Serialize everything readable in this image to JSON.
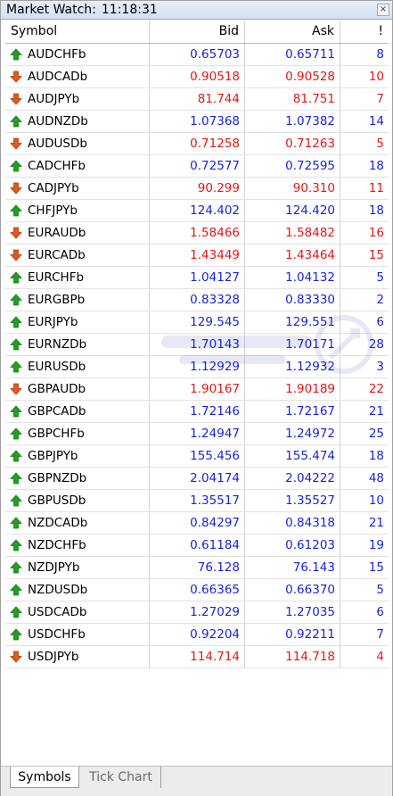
{
  "window": {
    "title": "Market Watch:",
    "time": "11:18:31",
    "close_glyph": "×"
  },
  "columns": {
    "symbol": "Symbol",
    "bid": "Bid",
    "ask": "Ask",
    "spread": "!"
  },
  "colors": {
    "up": "#1a24d6",
    "down": "#e01818",
    "arrow_up": "#1fa01f",
    "arrow_down": "#e05a1c"
  },
  "rows": [
    {
      "symbol": "AUDCHFb",
      "bid": "0.65703",
      "ask": "0.65711",
      "spread": "8",
      "dir": "up"
    },
    {
      "symbol": "AUDCADb",
      "bid": "0.90518",
      "ask": "0.90528",
      "spread": "10",
      "dir": "down"
    },
    {
      "symbol": "AUDJPYb",
      "bid": "81.744",
      "ask": "81.751",
      "spread": "7",
      "dir": "down"
    },
    {
      "symbol": "AUDNZDb",
      "bid": "1.07368",
      "ask": "1.07382",
      "spread": "14",
      "dir": "up"
    },
    {
      "symbol": "AUDUSDb",
      "bid": "0.71258",
      "ask": "0.71263",
      "spread": "5",
      "dir": "down"
    },
    {
      "symbol": "CADCHFb",
      "bid": "0.72577",
      "ask": "0.72595",
      "spread": "18",
      "dir": "up"
    },
    {
      "symbol": "CADJPYb",
      "bid": "90.299",
      "ask": "90.310",
      "spread": "11",
      "dir": "down"
    },
    {
      "symbol": "CHFJPYb",
      "bid": "124.402",
      "ask": "124.420",
      "spread": "18",
      "dir": "up"
    },
    {
      "symbol": "EURAUDb",
      "bid": "1.58466",
      "ask": "1.58482",
      "spread": "16",
      "dir": "down"
    },
    {
      "symbol": "EURCADb",
      "bid": "1.43449",
      "ask": "1.43464",
      "spread": "15",
      "dir": "down"
    },
    {
      "symbol": "EURCHFb",
      "bid": "1.04127",
      "ask": "1.04132",
      "spread": "5",
      "dir": "up"
    },
    {
      "symbol": "EURGBPb",
      "bid": "0.83328",
      "ask": "0.83330",
      "spread": "2",
      "dir": "up"
    },
    {
      "symbol": "EURJPYb",
      "bid": "129.545",
      "ask": "129.551",
      "spread": "6",
      "dir": "up"
    },
    {
      "symbol": "EURNZDb",
      "bid": "1.70143",
      "ask": "1.70171",
      "spread": "28",
      "dir": "up"
    },
    {
      "symbol": "EURUSDb",
      "bid": "1.12929",
      "ask": "1.12932",
      "spread": "3",
      "dir": "up"
    },
    {
      "symbol": "GBPAUDb",
      "bid": "1.90167",
      "ask": "1.90189",
      "spread": "22",
      "dir": "down"
    },
    {
      "symbol": "GBPCADb",
      "bid": "1.72146",
      "ask": "1.72167",
      "spread": "21",
      "dir": "up"
    },
    {
      "symbol": "GBPCHFb",
      "bid": "1.24947",
      "ask": "1.24972",
      "spread": "25",
      "dir": "up"
    },
    {
      "symbol": "GBPJPYb",
      "bid": "155.456",
      "ask": "155.474",
      "spread": "18",
      "dir": "up"
    },
    {
      "symbol": "GBPNZDb",
      "bid": "2.04174",
      "ask": "2.04222",
      "spread": "48",
      "dir": "up"
    },
    {
      "symbol": "GBPUSDb",
      "bid": "1.35517",
      "ask": "1.35527",
      "spread": "10",
      "dir": "up"
    },
    {
      "symbol": "NZDCADb",
      "bid": "0.84297",
      "ask": "0.84318",
      "spread": "21",
      "dir": "up"
    },
    {
      "symbol": "NZDCHFb",
      "bid": "0.61184",
      "ask": "0.61203",
      "spread": "19",
      "dir": "up"
    },
    {
      "symbol": "NZDJPYb",
      "bid": "76.128",
      "ask": "76.143",
      "spread": "15",
      "dir": "up"
    },
    {
      "symbol": "NZDUSDb",
      "bid": "0.66365",
      "ask": "0.66370",
      "spread": "5",
      "dir": "up"
    },
    {
      "symbol": "USDCADb",
      "bid": "1.27029",
      "ask": "1.27035",
      "spread": "6",
      "dir": "up"
    },
    {
      "symbol": "USDCHFb",
      "bid": "0.92204",
      "ask": "0.92211",
      "spread": "7",
      "dir": "up"
    },
    {
      "symbol": "USDJPYb",
      "bid": "114.714",
      "ask": "114.718",
      "spread": "4",
      "dir": "down"
    }
  ],
  "icons": {
    "up": "green-up-arrow-icon",
    "down": "red-down-arrow-icon",
    "watermark": "watermark-logo-icon"
  },
  "tabs": [
    {
      "label": "Symbols",
      "active": true
    },
    {
      "label": "Tick Chart",
      "active": false
    }
  ]
}
